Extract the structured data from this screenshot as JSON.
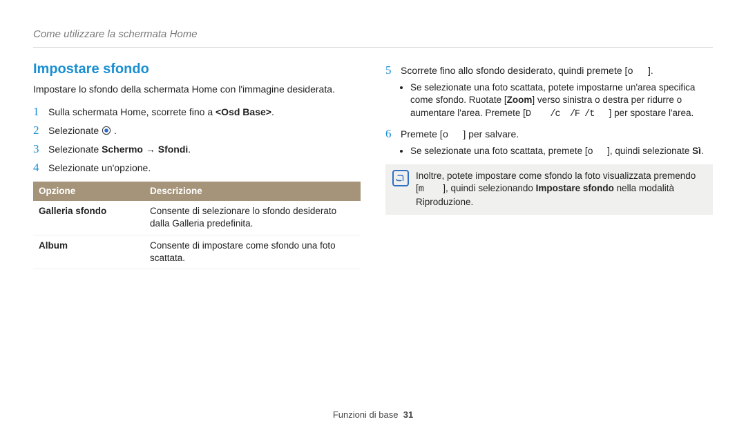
{
  "header": "Come utilizzare la schermata Home",
  "title": "Impostare sfondo",
  "intro": "Impostare lo sfondo della schermata Home con l'immagine desiderata.",
  "steps_left": [
    {
      "n": "1",
      "html": "Sulla schermata Home, scorrete fino a <b>&lt;Osd Base&gt;</b>."
    },
    {
      "n": "2",
      "html": "Selezionate {gear} ."
    },
    {
      "n": "3",
      "html": "Selezionate <b>Schermo → Sfondi</b>."
    },
    {
      "n": "4",
      "html": "Selezionate un'opzione."
    }
  ],
  "table": {
    "head_opt": "Opzione",
    "head_desc": "Descrizione",
    "rows": [
      {
        "name": "Galleria sfondo",
        "desc": "Consente di selezionare lo sfondo desiderato dalla Galleria predefinita."
      },
      {
        "name": "Album",
        "desc": "Consente di impostare come sfondo una foto scattata."
      }
    ]
  },
  "steps_right": [
    {
      "n": "5",
      "html": "Scorrete fino allo sfondo desiderato, quindi premete [<span class='bracket'>o&nbsp;&nbsp;&nbsp;</span>].",
      "sub": [
        "Se selezionate una foto scattata, potete impostarne un'area specifica come sfondo. Ruotate [<b>Zoom</b>] verso sinistra o destra per ridurre o aumentare l'area. Premete [<span class='bracket'>D&nbsp;&nbsp;&nbsp;&nbsp;/c&nbsp;&nbsp;/F&nbsp;/t&nbsp;&nbsp;&nbsp;</span>] per spostare l'area."
      ]
    },
    {
      "n": "6",
      "html": "Premete [<span class='bracket'>o&nbsp;&nbsp;&nbsp;</span>] per salvare.",
      "sub": [
        "Se selezionate una foto scattata, premete [<span class='bracket'>o&nbsp;&nbsp;&nbsp;</span>], quindi selezionate <b>Sì</b>."
      ]
    }
  ],
  "note_html": "Inoltre, potete impostare come sfondo la foto visualizzata premendo [<span class='bracket'>m&nbsp;&nbsp;&nbsp;&nbsp;</span>], quindi selezionando <b>Impostare sfondo</b> nella modalità Riproduzione.",
  "footer_label": "Funzioni di base",
  "footer_page": "31"
}
